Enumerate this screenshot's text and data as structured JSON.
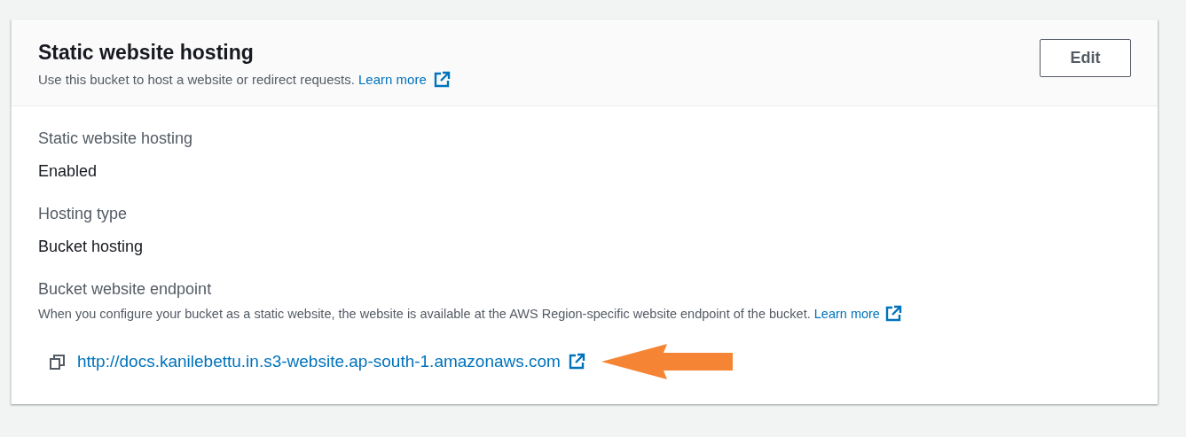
{
  "panel": {
    "title": "Static website hosting",
    "description": "Use this bucket to host a website or redirect requests.",
    "learn_more": "Learn more",
    "edit_button": "Edit"
  },
  "fields": [
    {
      "kind": "value",
      "label": "Static website hosting",
      "value": "Enabled"
    },
    {
      "kind": "value",
      "label": "Hosting type",
      "value": "Bucket hosting"
    },
    {
      "kind": "endpoint",
      "label": "Bucket website endpoint",
      "description": "When you configure your bucket as a static website, the website is available at the AWS Region-specific website endpoint of the bucket.",
      "learn_more": "Learn more",
      "url": "http://docs.kanilebettu.in.s3-website.ap-south-1.amazonaws.com"
    }
  ]
}
